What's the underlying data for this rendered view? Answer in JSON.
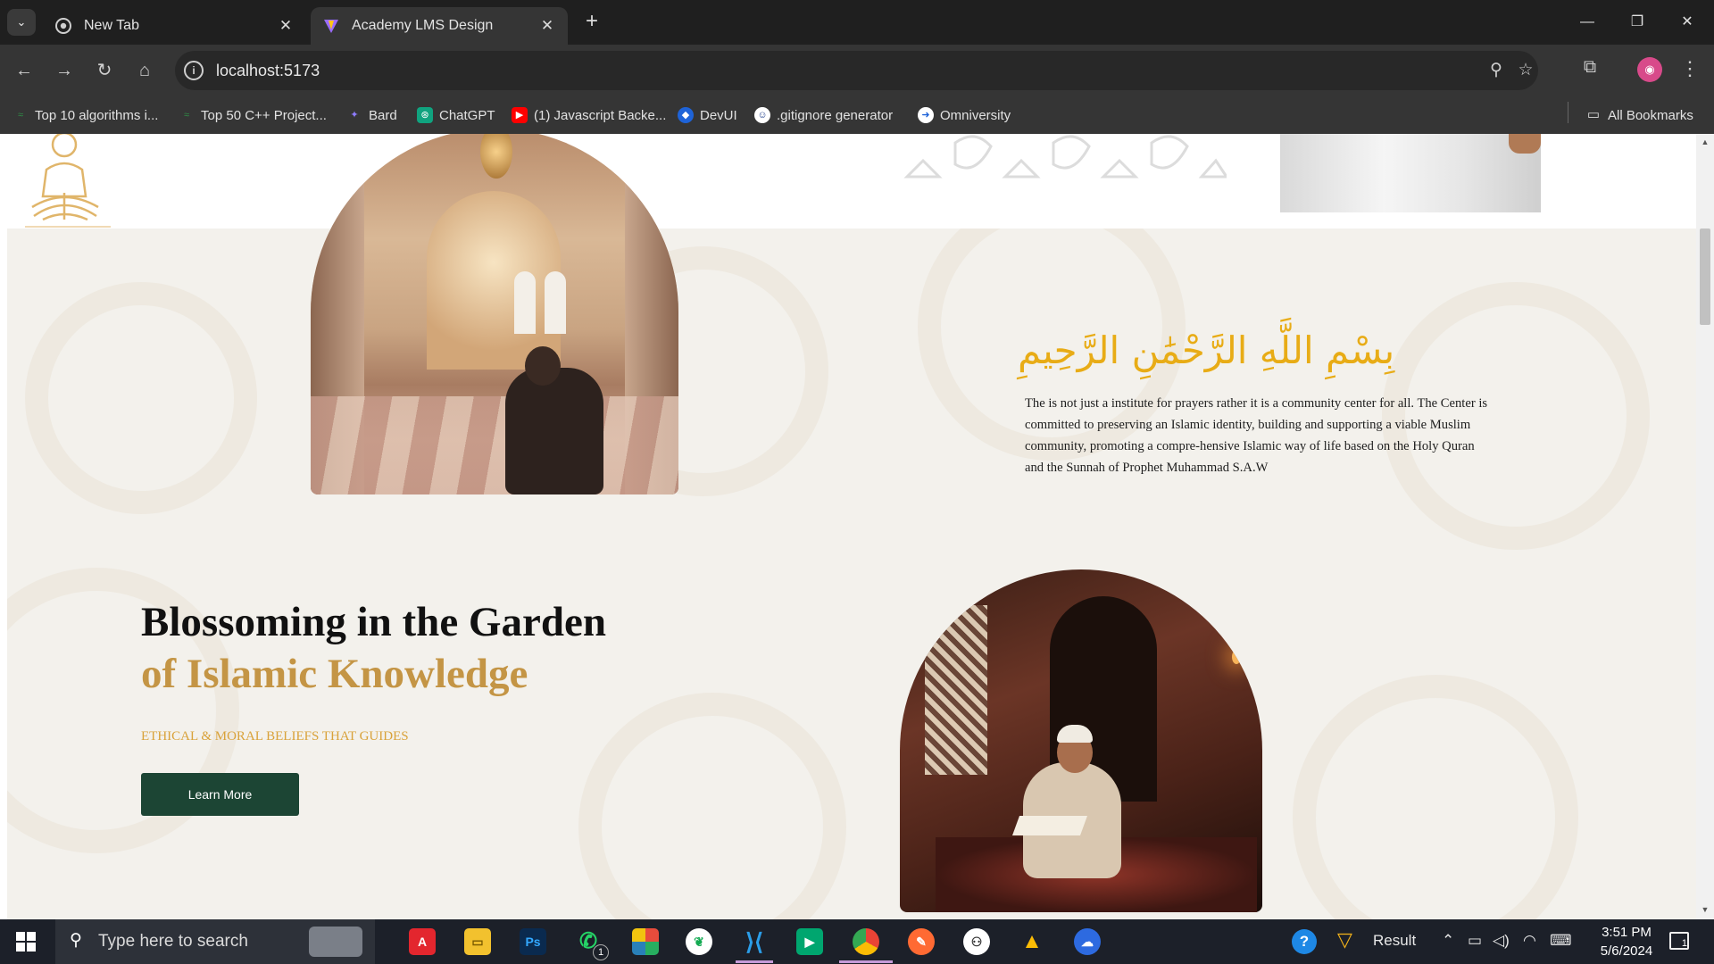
{
  "browser": {
    "tabs": [
      {
        "title": "New Tab",
        "active": false
      },
      {
        "title": "Academy LMS Design",
        "active": true
      }
    ],
    "address": "localhost:5173",
    "bookmarks": [
      "Top 10 algorithms i...",
      "Top 50 C++ Project...",
      "Bard",
      "ChatGPT",
      "(1) Javascript Backe...",
      "DevUI",
      ".gitignore generator",
      "Omniversity"
    ],
    "all_bookmarks": "All Bookmarks"
  },
  "page": {
    "bismillah": "بِسْمِ اللَّهِ الرَّحْمَٰنِ الرَّحِيمِ",
    "intro_text": "The is not just a institute for prayers rather it is a community center for all. The Center is committed to preserving an Islamic identity, building and supporting a viable Muslim community, promoting a compre-hensive Islamic way of life based on the Holy Quran and the Sunnah of Prophet Muhammad S.A.W",
    "heading_line1": "Blossoming in the Garden",
    "heading_line2": "of Islamic Knowledge",
    "subheading": "ETHICAL & MORAL BELIEFS THAT GUIDES",
    "cta_label": "Learn More"
  },
  "taskbar": {
    "search_placeholder": "Type here to search",
    "result_label": "Result",
    "time": "3:51 PM",
    "date": "5/6/2024",
    "whatsapp_badge": "1",
    "notification_count": "1"
  },
  "colors": {
    "accent_gold": "#c49545",
    "bismillah_gold": "#e8ac16",
    "button_green": "#1c4534",
    "section_bg": "#f3f1ec"
  }
}
